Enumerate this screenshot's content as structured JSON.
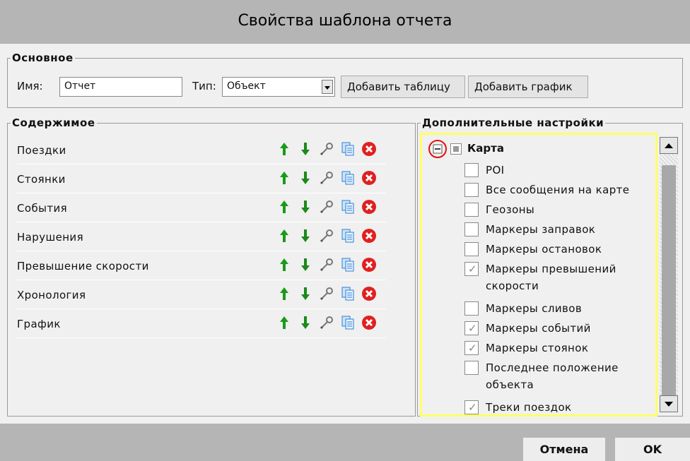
{
  "title": "Свойства шаблона отчета",
  "basic": {
    "legend": "Основное",
    "name_label": "Имя:",
    "name_value": "Отчет",
    "type_label": "Тип:",
    "type_value": "Объект",
    "add_table": "Добавить таблицу",
    "add_chart": "Добавить график"
  },
  "content": {
    "legend": "Содержимое",
    "items": [
      {
        "label": "Поездки"
      },
      {
        "label": "Стоянки"
      },
      {
        "label": "События"
      },
      {
        "label": "Нарушения"
      },
      {
        "label": "Превышение скорости"
      },
      {
        "label": "Хронология"
      },
      {
        "label": "График"
      }
    ]
  },
  "extra": {
    "legend": "Дополнительные настройки",
    "root": {
      "label": "Карта",
      "expanded": true
    },
    "children": [
      {
        "label": "POI",
        "checked": false
      },
      {
        "label": "Все сообщения на карте",
        "checked": false
      },
      {
        "label": "Геозоны",
        "checked": false
      },
      {
        "label": "Маркеры заправок",
        "checked": false
      },
      {
        "label": "Маркеры остановок",
        "checked": false
      },
      {
        "label": "Маркеры превышений",
        "label2": "скорости",
        "checked": true
      },
      {
        "label": "Маркеры сливов",
        "checked": false
      },
      {
        "label": "Маркеры событий",
        "checked": true
      },
      {
        "label": "Маркеры стоянок",
        "checked": true
      },
      {
        "label": "Последнее положение",
        "label2": "объекта",
        "checked": false
      },
      {
        "label": "Треки поездок",
        "checked": true
      }
    ]
  },
  "footer": {
    "cancel": "Отмена",
    "ok": "OK"
  },
  "colors": {
    "up_arrow": "#1a9a1a",
    "down_arrow": "#1a8a1a",
    "delete": "#e02020",
    "copy": "#2a7fd4",
    "highlight_border": "#ffff66"
  }
}
